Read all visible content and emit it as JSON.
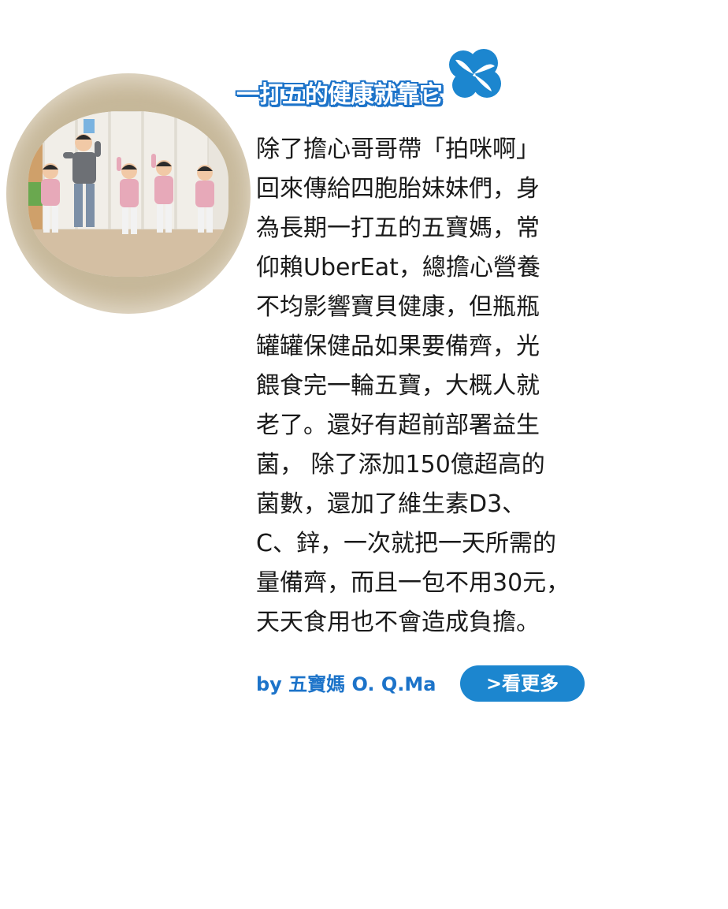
{
  "title": "一打五的健康就靠它",
  "photo": {
    "caption_icon": "family-photo"
  },
  "body_lines": [
    "除了擔心哥哥帶「拍咪啊」",
    "回來傳給四胞胎妹妹們，身",
    "為長期一打五的五寶媽，常",
    "仰賴UberEat，總擔心營養",
    "不均影響寶貝健康，但瓶瓶",
    "罐罐保健品如果要備齊，光",
    "餵食完一輪五寶，大概人就",
    "老了。還好有超前部署益生",
    "菌， 除了添加150億超高的",
    "菌數，還加了維生素D3、",
    "C、鋅，一次就把一天所需的",
    "量備齊，而且一包不用30元，",
    "天天食用也不會造成負擔。"
  ],
  "byline": "by 五寶媽 O. Q.Ma",
  "more_button": ">看更多",
  "colors": {
    "accent": "#1c73c9",
    "button": "#1c86cf",
    "text": "#1a1a1a"
  }
}
